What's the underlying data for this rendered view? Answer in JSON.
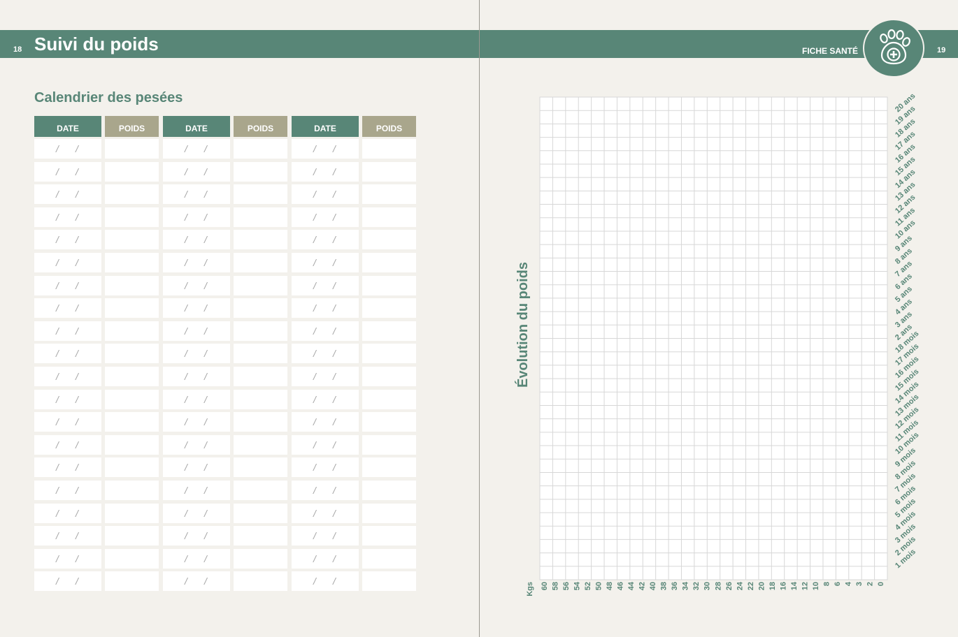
{
  "left_page": {
    "page_number": "18",
    "title": "Suivi du poids",
    "subtitle": "Calendrier des pesées",
    "table": {
      "column_groups": [
        {
          "date_label": "DATE",
          "weight_label": "POIDS"
        },
        {
          "date_label": "DATE",
          "weight_label": "POIDS"
        },
        {
          "date_label": "DATE",
          "weight_label": "POIDS"
        }
      ],
      "row_count": 20,
      "date_separator": "/"
    }
  },
  "right_page": {
    "page_number": "19",
    "section_label": "FICHE SANTÉ",
    "logo_icon": "paw-cross-icon",
    "chart_title": "Évolution du poids"
  },
  "colors": {
    "accent": "#588677",
    "weight_header": "#a9a68c",
    "paper": "#f3f1ec",
    "grid_line": "#d7d7d7"
  },
  "chart_data": {
    "type": "table",
    "title": "Évolution du poids",
    "xlabel": "Kgs",
    "x_ticks": [
      "60",
      "58",
      "56",
      "54",
      "52",
      "50",
      "48",
      "46",
      "44",
      "42",
      "40",
      "38",
      "36",
      "34",
      "32",
      "30",
      "28",
      "26",
      "24",
      "22",
      "20",
      "18",
      "16",
      "14",
      "12",
      "10",
      "8",
      "6",
      "4",
      "3",
      "2",
      "0"
    ],
    "y_ticks": [
      "20 ans",
      "19 ans",
      "18 ans",
      "17 ans",
      "16 ans",
      "15 ans",
      "14 ans",
      "13 ans",
      "12 ans",
      "11 ans",
      "10 ans",
      "9 ans",
      "8 ans",
      "7 ans",
      "6 ans",
      "5 ans",
      "4 ans",
      "3 ans",
      "2 ans",
      "18 mois",
      "17 mois",
      "16 mois",
      "15 mois",
      "14 mois",
      "13 mois",
      "12 mois",
      "11 mois",
      "10 mois",
      "9 mois",
      "8 mois",
      "7 mois",
      "6 mois",
      "5 mois",
      "4 mois",
      "3 mois",
      "2 mois",
      "1 mois"
    ],
    "grid": true
  }
}
